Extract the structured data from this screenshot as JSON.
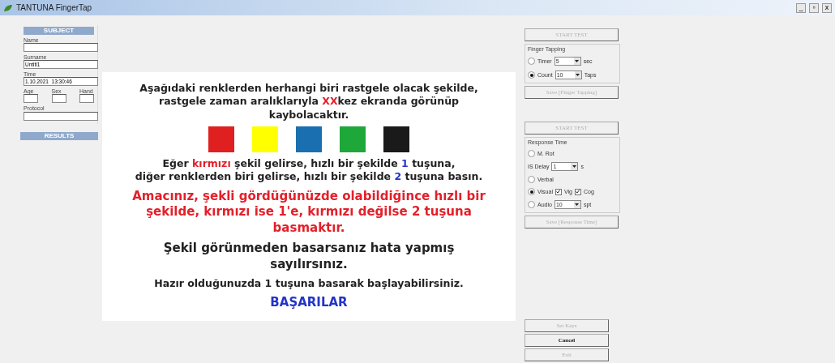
{
  "window": {
    "title": "TANTUNA FingerTap",
    "controls": [
      "_",
      "▫",
      "x"
    ]
  },
  "subject": {
    "header": "SUBJECT",
    "fields": [
      {
        "label": "Name"
      },
      {
        "label": "Surname",
        "value": "Untitl1"
      },
      {
        "label": "Time",
        "value": "1.10.2021  13:30:46"
      }
    ],
    "small_fields": [
      {
        "label": "Age"
      },
      {
        "label": "Sex"
      },
      {
        "label": "Hand"
      }
    ],
    "protocol": {
      "label": "Protocol"
    },
    "results_header": "RESULTS"
  },
  "instructions": {
    "paragraphs": [
      {
        "kind": "text",
        "large": false,
        "lines": [
          [
            {
              "text": "Aşağıdaki renklerden herhangi biri rastgele olacak şekilde,"
            }
          ],
          [
            {
              "text": "rastgele zaman aralıklarıyla "
            },
            {
              "text": "XX",
              "color": "#e3202a"
            },
            {
              "text": "kez ekranda görünüp"
            }
          ],
          [
            {
              "text": "kaybolacaktır."
            }
          ]
        ]
      },
      {
        "kind": "swatches",
        "colors": [
          {
            "color": "#e02020"
          },
          {
            "color": "#ffff00"
          },
          {
            "color": "#1a6fb0"
          },
          {
            "color": "#1fa83a"
          },
          {
            "color": "#1a1a1a"
          }
        ]
      },
      {
        "kind": "text",
        "large": false,
        "lines": [
          [
            {
              "text": "Eğer "
            },
            {
              "text": "kırmızı",
              "color": "#e3202a"
            },
            {
              "text": " şekil gelirse, hızlı bir şekilde "
            },
            {
              "text": "1",
              "color": "#2434c8"
            },
            {
              "text": " tuşuna,"
            }
          ],
          [
            {
              "text": "diğer renklerden biri gelirse, hızlı bir şekilde "
            },
            {
              "text": "2",
              "color": "#2434c8"
            },
            {
              "text": " tuşuna basın."
            }
          ]
        ]
      },
      {
        "kind": "text",
        "large": true,
        "lines": [
          [
            {
              "text": "Amacınız, şekli gördüğünüzde olabildiğince hızlı bir",
              "color": "#e3202a"
            }
          ],
          [
            {
              "text": "şekilde, kırmızı ise 1'e, kırmızı değilse 2 tuşuna",
              "color": "#e3202a"
            }
          ],
          [
            {
              "text": "basmaktır.",
              "color": "#e3202a"
            }
          ]
        ]
      },
      {
        "kind": "text",
        "large": true,
        "lines": [
          [
            {
              "text": "Şekil görünmeden basarsanız hata yapmış"
            }
          ],
          [
            {
              "text": "sayılırsınız."
            }
          ]
        ]
      },
      {
        "kind": "text",
        "large": false,
        "lines": [
          [
            {
              "text": "Hazır olduğunuzda 1 tuşuna basarak başlayabilirsiniz."
            }
          ]
        ]
      },
      {
        "kind": "text",
        "large": true,
        "lines": [
          [
            {
              "text": "BAŞARILAR",
              "color": "#2434c8"
            }
          ]
        ]
      }
    ]
  },
  "finger_tapping": {
    "start": {
      "label": "START TEST",
      "disabled": true
    },
    "title": "Finger Tapping",
    "options": [
      {
        "label": "Timer",
        "selected": false,
        "select": "5",
        "unit": "sec"
      },
      {
        "label": "Count",
        "selected": true,
        "select": "10",
        "unit": "Taps"
      }
    ],
    "save": {
      "label": "Save [Finger Tapping]",
      "disabled": true
    }
  },
  "response_time": {
    "start": {
      "label": "START TEST",
      "disabled": true
    },
    "title": "Response Time",
    "mrot": {
      "label": "M. Rot",
      "selected": false,
      "delay_label": "IS Delay",
      "delay": "1",
      "unit": "s"
    },
    "verbal": {
      "label": "Verbal",
      "selected": false
    },
    "visual": {
      "label": "Visual",
      "selected": true,
      "checks": [
        {
          "label": "Vig",
          "checked": true
        },
        {
          "label": "Cog",
          "checked": true
        }
      ]
    },
    "audio": {
      "label": "Audio",
      "selected": false,
      "select": "10",
      "unit": "spt"
    },
    "save": {
      "label": "Save [Response Time]",
      "disabled": true
    }
  },
  "buttons": [
    {
      "label": "Set Keys",
      "disabled": true
    },
    {
      "label": "Cancel",
      "disabled": false
    },
    {
      "label": "Exit",
      "disabled": true
    }
  ]
}
